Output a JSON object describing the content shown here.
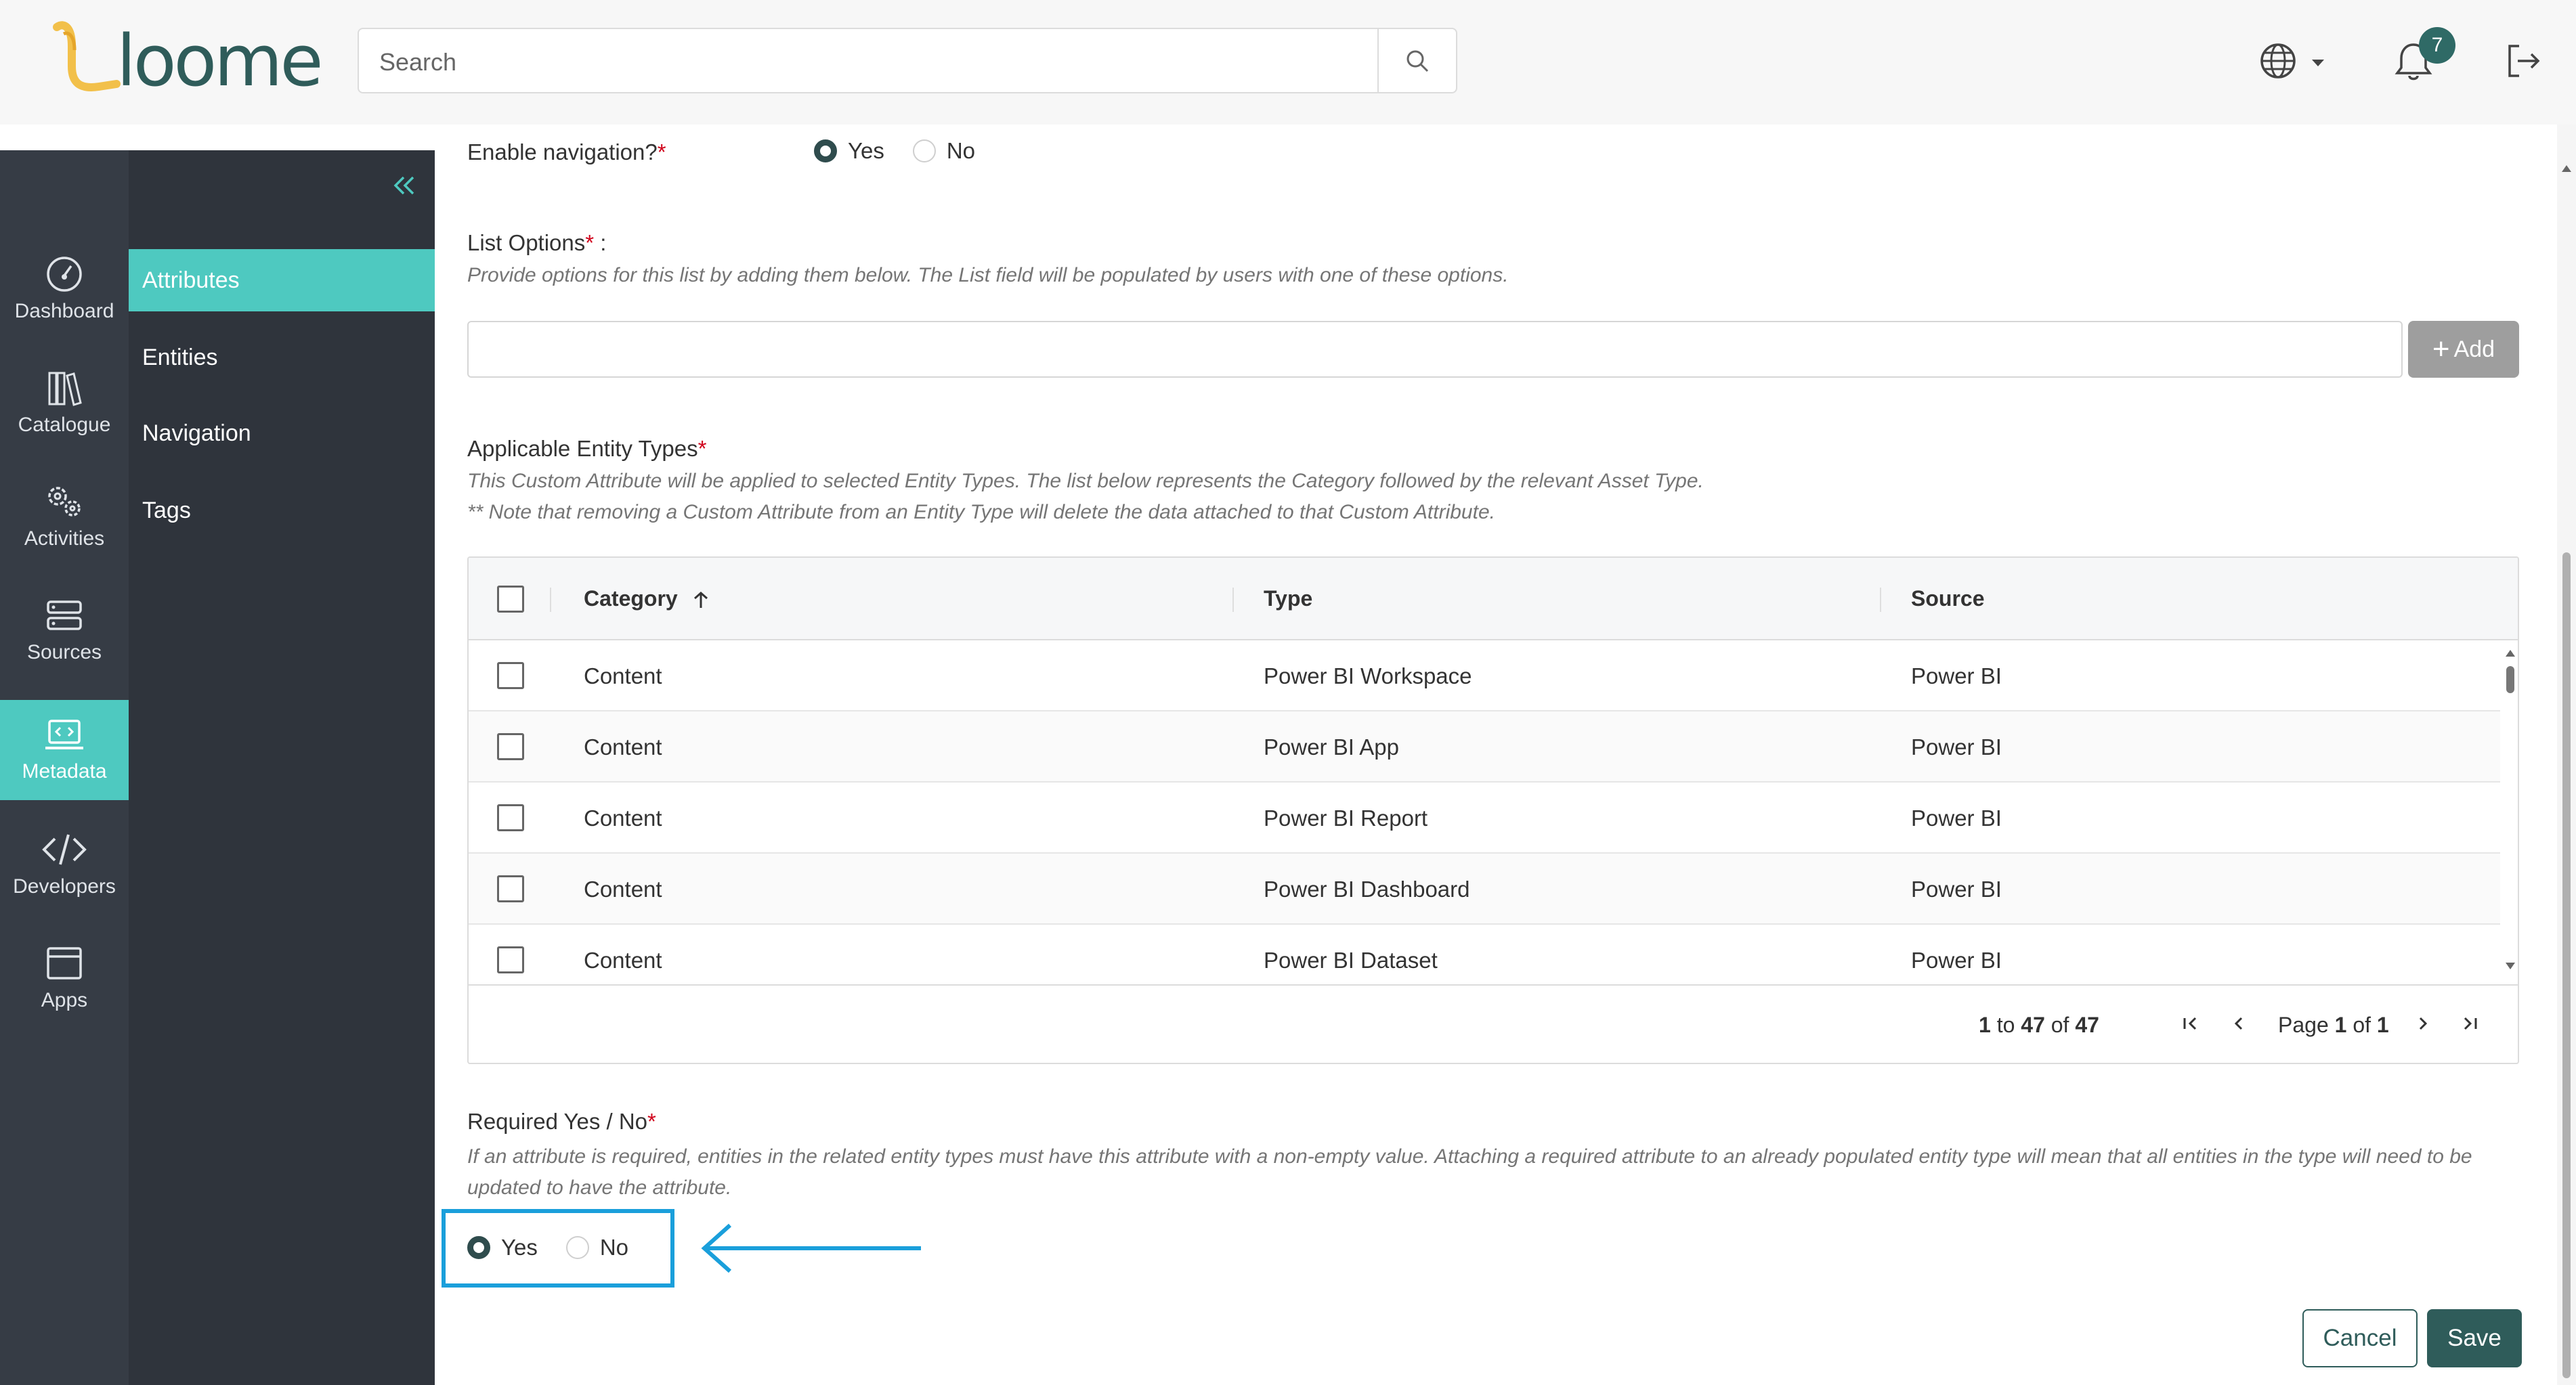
{
  "brand": {
    "name": "loome",
    "accent": "#4ec9c0",
    "dark": "#2f5c5a"
  },
  "search": {
    "placeholder": "Search"
  },
  "header": {
    "notification_count": "7"
  },
  "rail": {
    "items": [
      {
        "label": "Dashboard",
        "icon": "dashboard-icon"
      },
      {
        "label": "Catalogue",
        "icon": "catalogue-icon"
      },
      {
        "label": "Activities",
        "icon": "activities-icon"
      },
      {
        "label": "Sources",
        "icon": "sources-icon"
      },
      {
        "label": "Metadata",
        "icon": "metadata-icon"
      },
      {
        "label": "Developers",
        "icon": "code-icon"
      },
      {
        "label": "Apps",
        "icon": "apps-icon"
      }
    ]
  },
  "subnav": {
    "items": [
      "Attributes",
      "Entities",
      "Navigation",
      "Tags"
    ]
  },
  "form": {
    "enable_nav": {
      "label": "Enable navigation?",
      "req": "*",
      "yes": "Yes",
      "no": "No"
    },
    "list_options": {
      "label": "List Options",
      "req": "*",
      "suffix": " :",
      "help": "Provide options for this list by adding them below. The List field will be populated by users with one of these options.",
      "add": "Add"
    },
    "entity_types": {
      "label": "Applicable Entity Types",
      "req": "*",
      "help1": "This Custom Attribute will be applied to selected Entity Types. The list below represents the Category followed by the relevant Asset Type.",
      "help2": "** Note that removing a Custom Attribute from an Entity Type will delete the data attached to that Custom Attribute."
    },
    "grid": {
      "headers": [
        "Category",
        "Type",
        "Source"
      ],
      "rows": [
        [
          "Content",
          "Power BI Workspace",
          "Power BI"
        ],
        [
          "Content",
          "Power BI App",
          "Power BI"
        ],
        [
          "Content",
          "Power BI Report",
          "Power BI"
        ],
        [
          "Content",
          "Power BI Dashboard",
          "Power BI"
        ],
        [
          "Content",
          "Power BI Dataset",
          "Power BI"
        ]
      ],
      "paging": {
        "from": "1",
        "to_word": "to",
        "to": "47",
        "of_word": "of",
        "total": "47",
        "page_word": "Page",
        "page": "1",
        "pages": "1"
      }
    },
    "required": {
      "label": "Required Yes / No",
      "req": "*",
      "help": "If an attribute is required, entities in the related entity types must have this attribute with a non-empty value. Attaching a required attribute to an already populated entity type will mean that all entities in the type will need to be updated to have the attribute.",
      "yes": "Yes",
      "no": "No"
    },
    "actions": {
      "cancel": "Cancel",
      "save": "Save"
    }
  }
}
